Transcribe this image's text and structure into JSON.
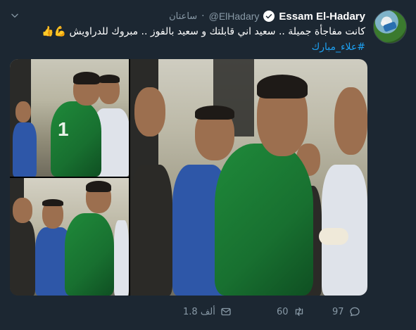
{
  "tweet": {
    "display_name": "Essam El-Hadary",
    "handle": "@ElHadary",
    "separator": "·",
    "time": "ساعتان",
    "text": "كانت مفاجأة جميلة .. سعيد اني قابلتك و سعيد بالفوز .. مبروك للدراويش",
    "emoji": "💪👍",
    "hashtag": "#علاء_مبارك"
  },
  "actions": {
    "reply_count": "97",
    "retweet_count": "60",
    "like_count": "1.8 ألف"
  },
  "icons": {
    "verified": "verified-badge-icon",
    "more": "chevron-down-icon",
    "reply": "reply-icon",
    "retweet": "retweet-icon",
    "like": "like-icon"
  },
  "colors": {
    "background": "#1c2732",
    "accent": "#1da1f2",
    "muted": "#8899a6"
  }
}
